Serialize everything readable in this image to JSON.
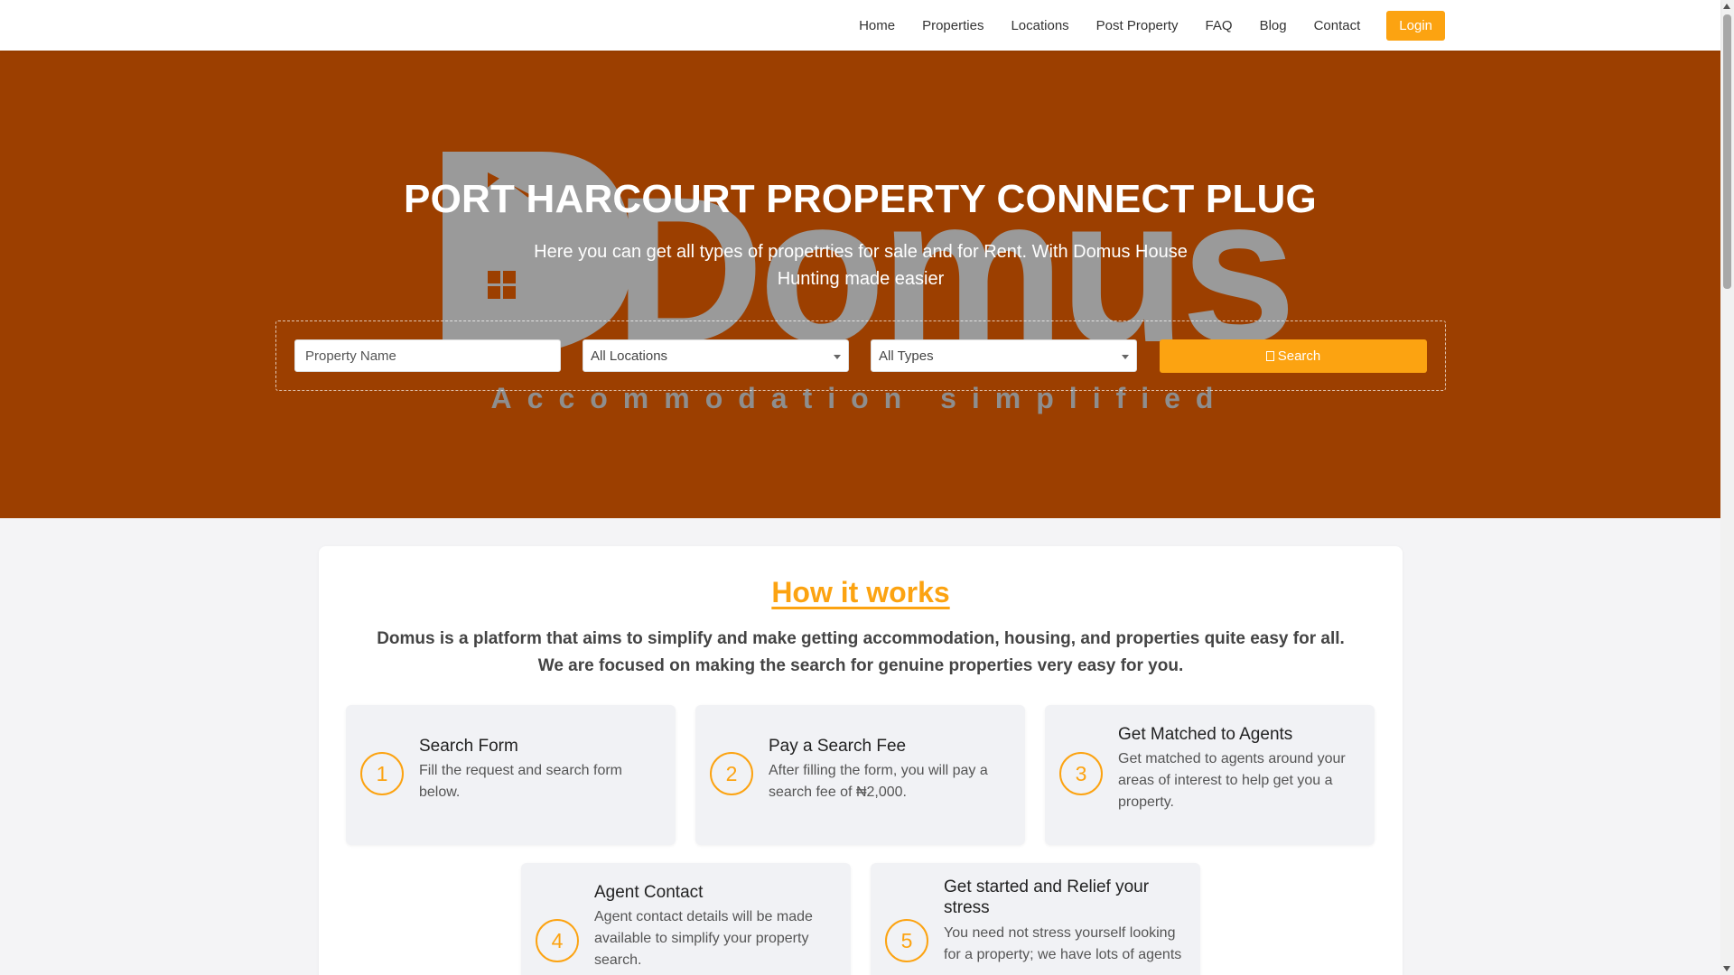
{
  "nav": {
    "items": [
      "Home",
      "Properties",
      "Locations",
      "Post Property",
      "FAQ",
      "Blog",
      "Contact"
    ],
    "login_label": "Login"
  },
  "hero": {
    "logo_text": "Domus",
    "logo_tagline": "Accommodation simplified",
    "title": "PORT HARCOURT PROPERTY CONNECT PLUG",
    "subtitle": "Here you can get all types of propetrties for sale and for Rent. With Domus House Hunting made easier"
  },
  "search": {
    "name_placeholder": "Property Name",
    "location_selected": "All Locations",
    "type_selected": "All Types",
    "button_label": "Search",
    "button_icon": "search-icon"
  },
  "how": {
    "title": "How it works",
    "description": "Domus is a platform that aims to simplify and make getting accommodation, housing, and properties quite easy for all. We are focused on making the search for genuine properties very easy for you.",
    "steps": [
      {
        "number": "1",
        "title": "Search Form",
        "text": "Fill the request and search form below."
      },
      {
        "number": "2",
        "title": "Pay a Search Fee",
        "text": "After filling the form, you will pay a search fee of ₦2,000."
      },
      {
        "number": "3",
        "title": "Get Matched to Agents",
        "text": "Get matched to agents around your areas of interest to help get you a property."
      },
      {
        "number": "4",
        "title": "Agent Contact",
        "text": "Agent contact details will be made available to simplify your property search."
      },
      {
        "number": "5",
        "title": "Get started and Relief your stress",
        "text": "You need not stress yourself looking for a property; we have lots of agents"
      }
    ]
  },
  "colors": {
    "accent": "#fca311",
    "hero_bg": "#9c3f00",
    "logo_gray": "#9a9a9a"
  }
}
